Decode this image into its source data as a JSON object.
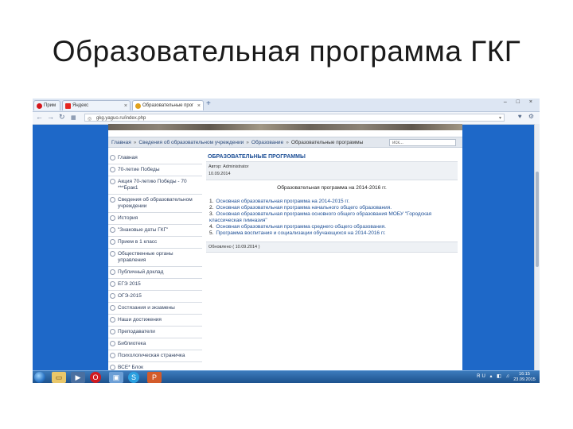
{
  "slide": {
    "title": "Образовательная программа ГКГ"
  },
  "browser": {
    "tabs": [
      {
        "label": "Прим",
        "icon": "opera-icon"
      },
      {
        "label": "Яндекс",
        "icon": "yandex-icon"
      },
      {
        "label": "Образовательные прог",
        "icon": "site-icon"
      }
    ],
    "new_tab": "+",
    "window_controls": "– □ ×",
    "address": "gkg.yaguo.ru/index.php"
  },
  "page": {
    "breadcrumb": {
      "items": [
        "Главная",
        "Сведения об образовательном учреждении",
        "Образование"
      ],
      "current": "Образовательные программы",
      "separator": "»"
    },
    "search_placeholder": "иск...",
    "menu": [
      "Главная",
      "70-летие Победы",
      "Акция 70-летию Победы - 70 ***Брак1",
      "Сведения об образовательном учреждении",
      "История",
      "\"Знаковые даты ГКГ\"",
      "Прием в 1 класс",
      "Общественные органы управления",
      "Публичный доклад",
      "ЕГЭ 2015",
      "ОГЭ-2015",
      "Состязания и экзамены",
      "Наши достижения",
      "Преподаватели",
      "Библиотека",
      "Психологическая страничка",
      "ВСЕ* Блок"
    ],
    "article": {
      "title": "ОБРАЗОВАТЕЛЬНЫЕ ПРОГРАММЫ",
      "author": "Автор: Administrator",
      "date": "10.09.2014",
      "subtitle": "Образовательная программа на 2014-2016 гг.",
      "programs": [
        {
          "num": "1.",
          "text": "Основная образовательная программа на 2014-2015 гг."
        },
        {
          "num": "2.",
          "text": "Основная образовательная программа начального общего образования."
        },
        {
          "num": "3.",
          "text": "Основная образовательная программа основного общего образования МОБУ \"Городская классическая гимназия\""
        },
        {
          "num": "4.",
          "text": "Основная образовательная программа среднего общего образования."
        },
        {
          "num": "5.",
          "text": "Программа воспитания и социализации обучающихся на 2014-2016 гг."
        }
      ],
      "updated": "Обновлено ( 10.09.2014 )"
    }
  },
  "taskbar": {
    "tray_lang": "RU",
    "time": "16:15",
    "date": "23.09.2015"
  }
}
